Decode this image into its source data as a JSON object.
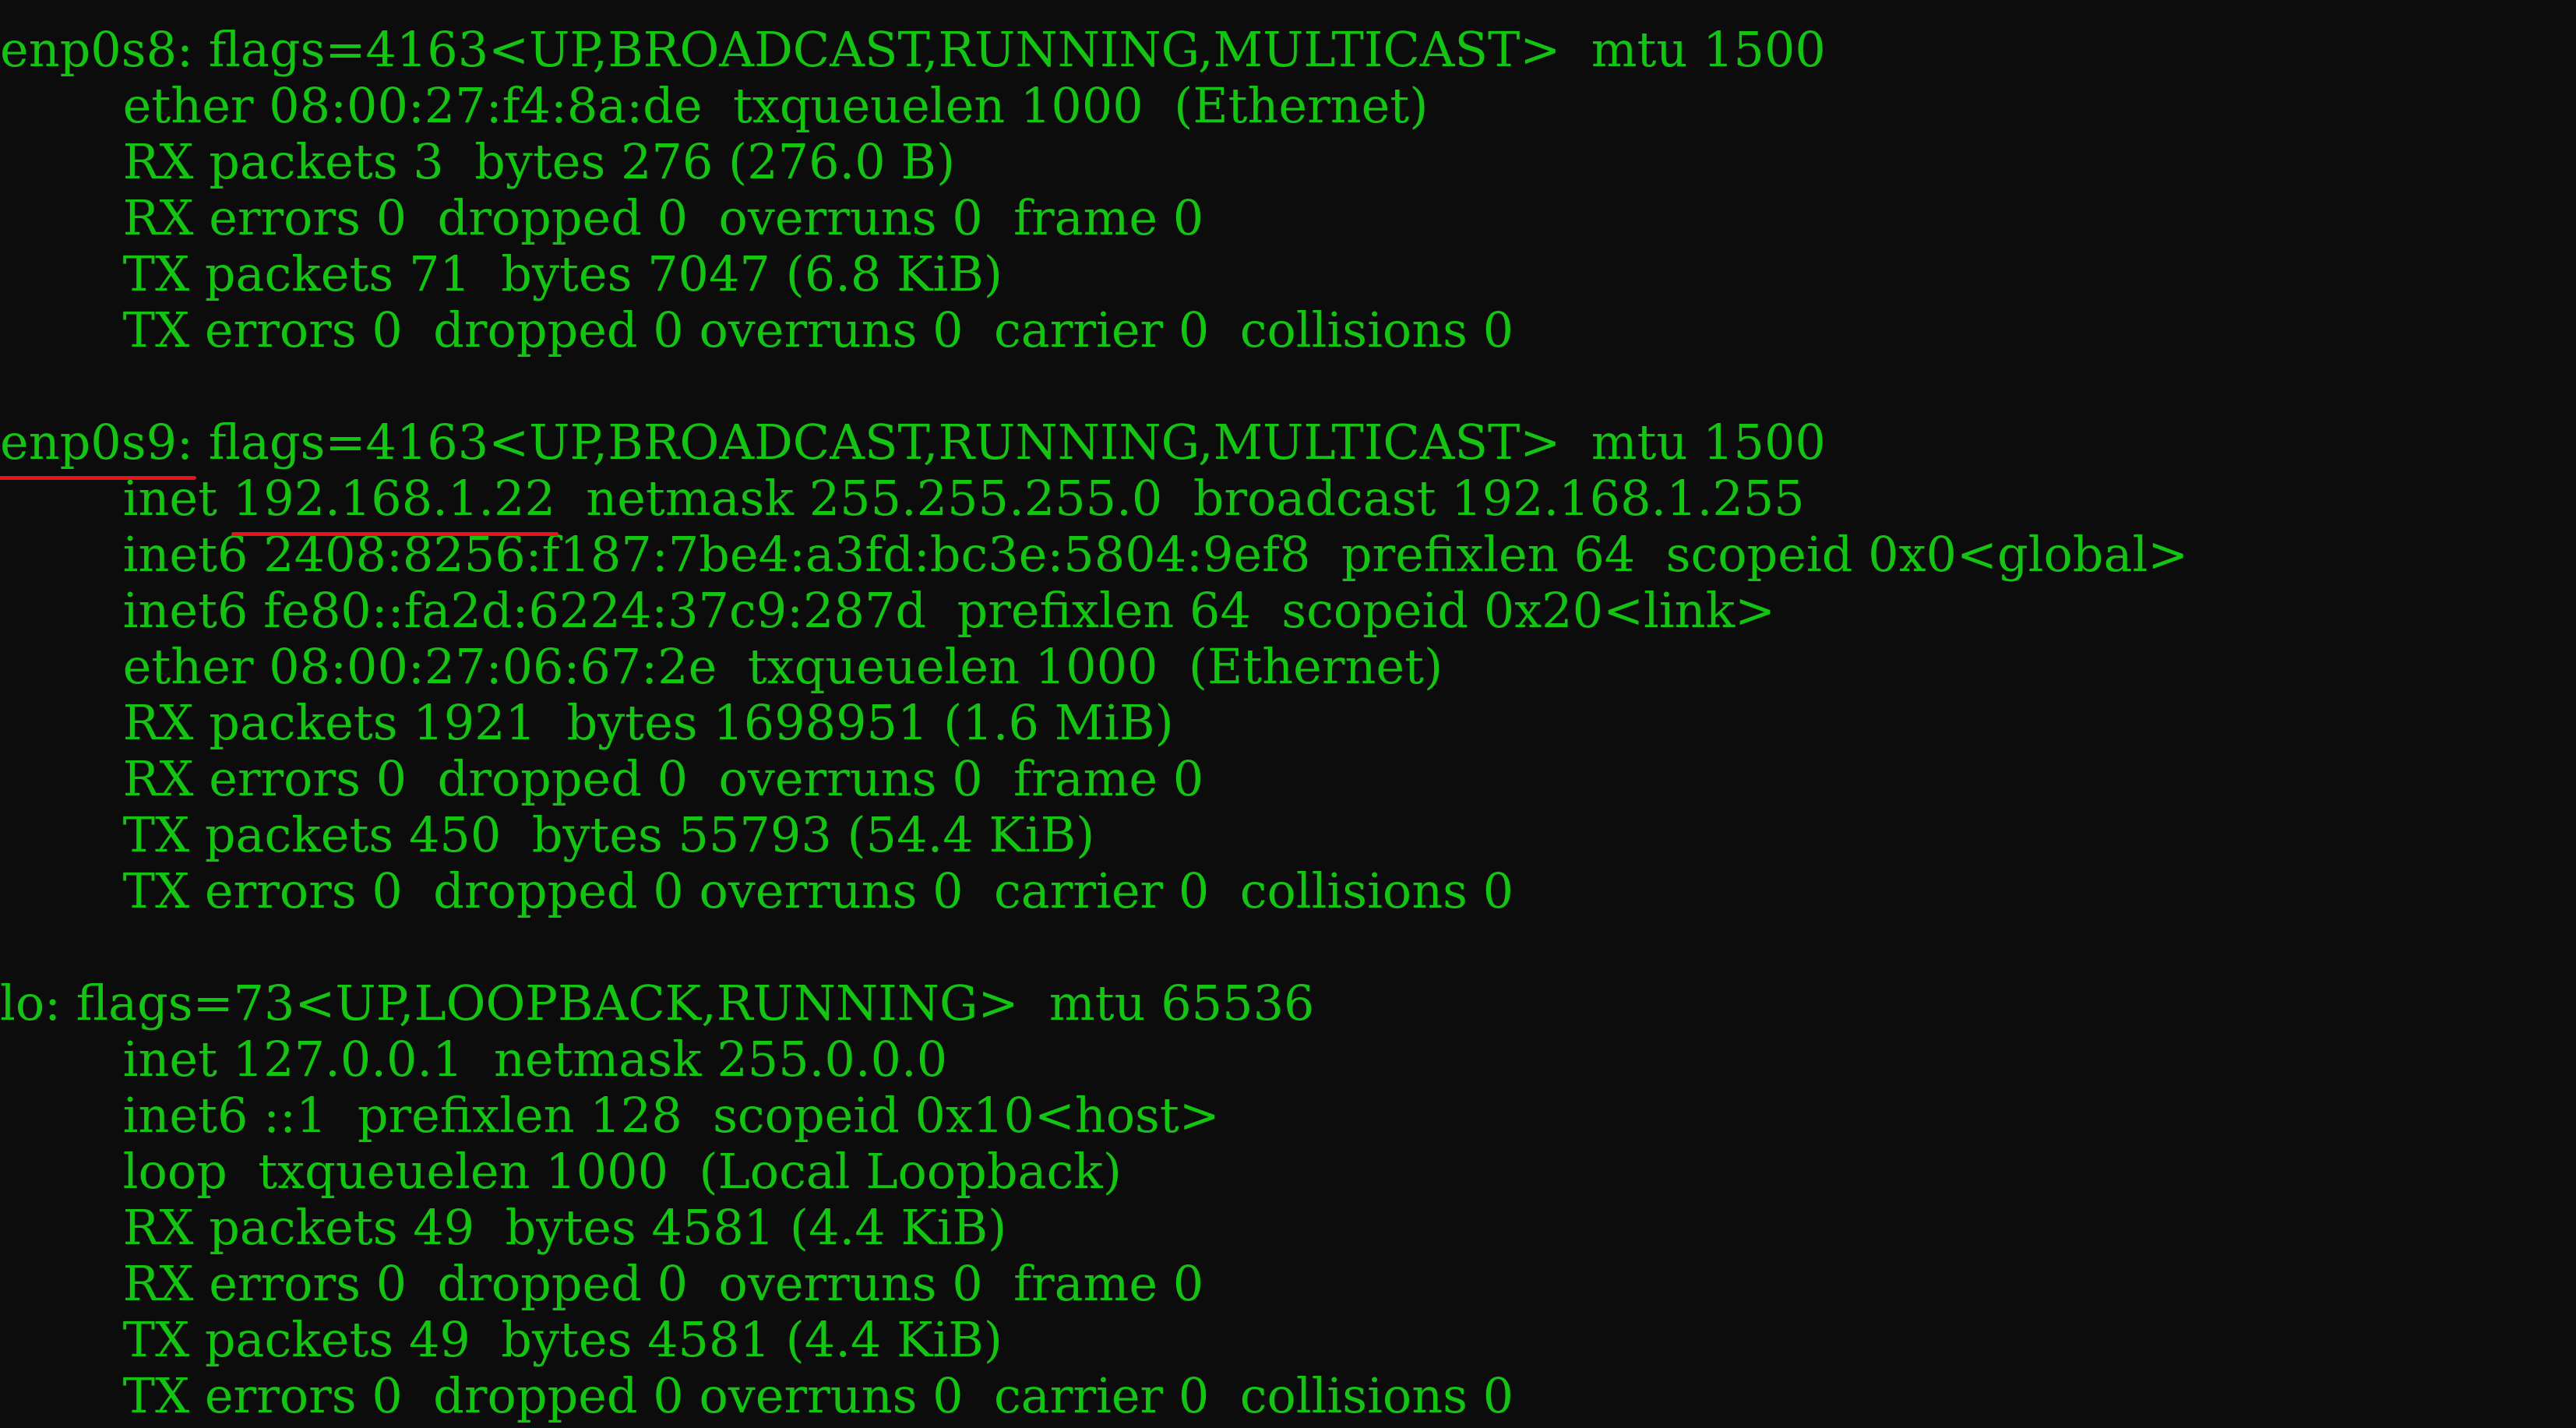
{
  "colors": {
    "background": "#0c0c0c",
    "text": "#13c413",
    "highlight_underline": "#e8121c"
  },
  "lines": [
    "enp0s8: flags=4163<UP,BROADCAST,RUNNING,MULTICAST>  mtu 1500",
    "        ether 08:00:27:f4:8a:de  txqueuelen 1000  (Ethernet)",
    "        RX packets 3  bytes 276 (276.0 B)",
    "        RX errors 0  dropped 0  overruns 0  frame 0",
    "        TX packets 71  bytes 7047 (6.8 KiB)",
    "        TX errors 0  dropped 0 overruns 0  carrier 0  collisions 0",
    "",
    {
      "indent": "",
      "highlight": "enp0s9:",
      "rest": " flags=4163<UP,BROADCAST,RUNNING,MULTICAST>  mtu 1500"
    },
    {
      "indent": "        inet ",
      "highlight": "192.168.1.22",
      "rest": "  netmask 255.255.255.0  broadcast 192.168.1.255"
    },
    "        inet6 2408:8256:f187:7be4:a3fd:bc3e:5804:9ef8  prefixlen 64  scopeid 0x0<global>",
    "        inet6 fe80::fa2d:6224:37c9:287d  prefixlen 64  scopeid 0x20<link>",
    "        ether 08:00:27:06:67:2e  txqueuelen 1000  (Ethernet)",
    "        RX packets 1921  bytes 1698951 (1.6 MiB)",
    "        RX errors 0  dropped 0  overruns 0  frame 0",
    "        TX packets 450  bytes 55793 (54.4 KiB)",
    "        TX errors 0  dropped 0 overruns 0  carrier 0  collisions 0",
    "",
    "lo: flags=73<UP,LOOPBACK,RUNNING>  mtu 65536",
    "        inet 127.0.0.1  netmask 255.0.0.0",
    "        inet6 ::1  prefixlen 128  scopeid 0x10<host>",
    "        loop  txqueuelen 1000  (Local Loopback)",
    "        RX packets 49  bytes 4581 (4.4 KiB)",
    "        RX errors 0  dropped 0  overruns 0  frame 0",
    "        TX packets 49  bytes 4581 (4.4 KiB)",
    "        TX errors 0  dropped 0 overruns 0  carrier 0  collisions 0"
  ]
}
